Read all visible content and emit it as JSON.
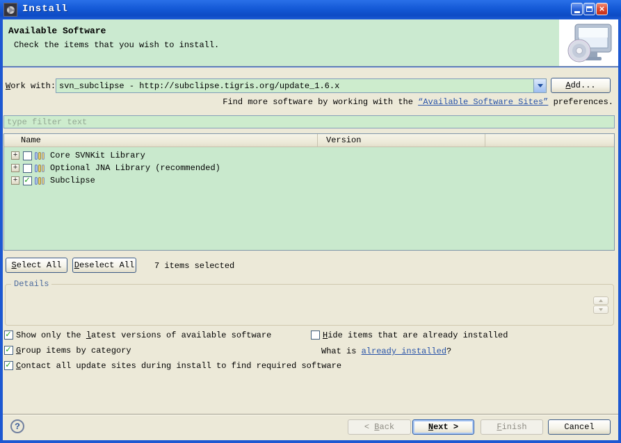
{
  "colors": {
    "titlebar_blue": "#1459d6",
    "banner_green": "#cbead0",
    "content_beige": "#ece9d8",
    "field_green": "#cdeccd",
    "link_blue": "#2853a8",
    "check_green": "#1fa11f",
    "close_red": "#dd4830"
  },
  "titlebar": {
    "title": "Install"
  },
  "banner": {
    "title": "Available Software",
    "subtitle": "Check the items that you wish to install."
  },
  "work_with": {
    "label_key": "W",
    "label_rest": "ork with:",
    "value": "svn_subclipse - http://subclipse.tigris.org/update_1.6.x",
    "add_key": "A",
    "add_rest": "dd..."
  },
  "find_more": {
    "pre": "Find more software by working with the ",
    "link": "“Available Software Sites”",
    "post": " preferences."
  },
  "filter": {
    "placeholder": "type filter text"
  },
  "table": {
    "columns": [
      "Name",
      "Version"
    ],
    "rows": [
      {
        "name": "Core SVNKit Library",
        "checked": false
      },
      {
        "name": "Optional JNA Library (recommended)",
        "checked": false
      },
      {
        "name": "Subclipse",
        "checked": true
      }
    ]
  },
  "selection": {
    "select_key": "S",
    "select_rest": "elect All",
    "deselect_key": "D",
    "deselect_rest": "eselect All",
    "status": "7 items selected"
  },
  "details": {
    "label": "Details"
  },
  "options": {
    "latest": {
      "pre": "Show only the ",
      "key": "l",
      "post": "atest versions of available software",
      "checked": true
    },
    "group": {
      "pre": "",
      "key": "G",
      "post": "roup items by category",
      "checked": true
    },
    "contact": {
      "pre": "",
      "key": "C",
      "post": "ontact all update sites during install to find required software",
      "checked": true
    },
    "hide": {
      "pre": "",
      "key": "H",
      "post": "ide items that are already installed",
      "checked": false
    },
    "what_is": {
      "pre": "What is ",
      "link": "already installed",
      "post": "?"
    }
  },
  "footer": {
    "back": {
      "pre": "< ",
      "key": "B",
      "post": "ack",
      "enabled": false
    },
    "next": {
      "pre": "",
      "key": "N",
      "post": "ext >",
      "enabled": true
    },
    "finish": {
      "pre": "",
      "key": "F",
      "post": "inish",
      "enabled": false
    },
    "cancel": {
      "pre": "",
      "key": "",
      "post": "Cancel",
      "enabled": true
    },
    "help": "?"
  }
}
